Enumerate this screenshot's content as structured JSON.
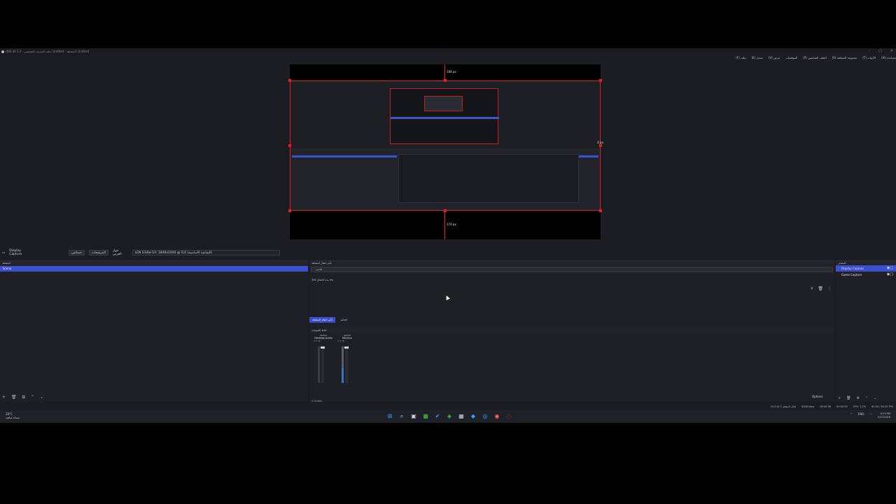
{
  "window": {
    "title": "OBS 30.1.2 - ملف التعريف الشخصي: Untitled - المشاهد: Untitled",
    "minimize": "–",
    "maximize": "□",
    "close": "✕"
  },
  "menu": [
    "ملف (F)",
    "تعديل (E)",
    "عرض (V)",
    "الموقفيات",
    "الملف الشخصي (P)",
    "مجموعة المشاهد (S)",
    "الأدوات (T)",
    "مساعدة (H)"
  ],
  "preview": {
    "top_px": "184 px",
    "right_px": "4 px",
    "bottom_px": "174 px"
  },
  "source_bar": {
    "selected_source": "Display Capture",
    "properties_btn": "خصائص",
    "filters_btn": "المرشحات",
    "display_label": "جهاز العرض",
    "display_value": "LEN G34w-10: 3440x1440 @ 0,0 (الشاشة الأساسية)"
  },
  "scenes": {
    "header": "المشاهد",
    "items": [
      "Scene"
    ]
  },
  "transitions": {
    "header": "تأثير انتقال المشاهد",
    "type": "تلاشي",
    "duration_label": "مدة الانتقال",
    "duration_value": "300 ms",
    "tab_active": "تأثير انتقال المشاهد",
    "tab_other": "التحكم"
  },
  "mixer": {
    "header": "خلاط الصوتيات",
    "channels": [
      {
        "name": "Global",
        "device": "Desktop Audio",
        "db": "0.0 dB"
      },
      {
        "name": "Global",
        "device": "Mic/Aux",
        "db": "0.0 dB"
      }
    ],
    "hidden": "0 hidden"
  },
  "sources": {
    "header": "المصادر",
    "items": [
      {
        "name": "Display Capture",
        "selected": true
      },
      {
        "name": "Game Capture",
        "selected": false
      }
    ]
  },
  "controls_options": "Options",
  "status": {
    "dropped": "إطار المشغل 0 (0.0 %)",
    "bitrate": "6006 kbps",
    "rec_time": "00:00:06",
    "stream_time": "00:00:00",
    "cpu": "CPU: 1.2%",
    "fps": "60.00 / 60.00 FPS"
  },
  "taskbar": {
    "weather_temp": "28°C",
    "weather_desc": "سماء صافية",
    "lang": "ENG",
    "time": "8:33 PM",
    "date": "5/27/2026"
  }
}
